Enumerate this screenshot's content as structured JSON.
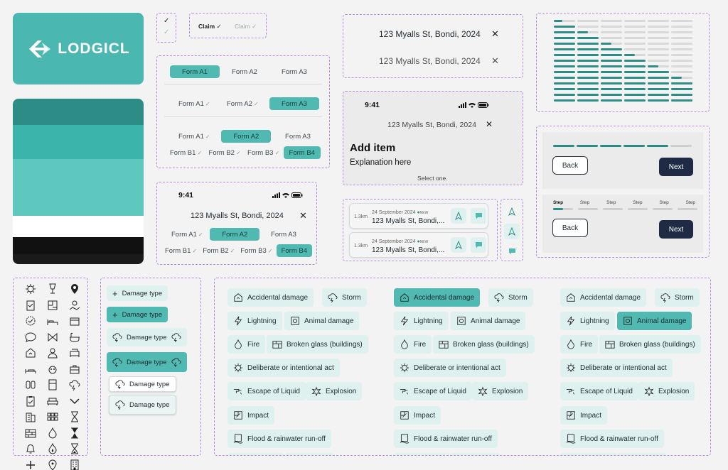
{
  "brand": {
    "name": "LODGICL",
    "color": "#4ab8b0"
  },
  "palette": [
    "#2e8c86",
    "#3bb5ac",
    "#5ec7be",
    "#ffffff",
    "#1a1a1a"
  ],
  "claim": {
    "label_active": "Claim",
    "label_inactive": "Claim"
  },
  "forms": {
    "row1": [
      "Form A1",
      "Form A2",
      "Form A3"
    ],
    "row2": [
      "Form A1",
      "Form A2",
      "Form A3"
    ],
    "row3a": [
      "Form A1",
      "Form A2",
      "Form A3"
    ],
    "row3b": [
      "Form B1",
      "Form B2",
      "Form B3",
      "Form B4"
    ]
  },
  "phone": {
    "time": "9:41",
    "address": "123 Myalls St, Bondi, 2024"
  },
  "addresses": [
    "123 Myalls St, Bondi, 2024",
    "123 Myalls St, Bondi, 2024"
  ],
  "add_item": {
    "time": "9:41",
    "address": "123 Myalls St, Bondi, 2024",
    "title": "Add item",
    "subtitle": "Explanation here",
    "hint": "Select one."
  },
  "list_items": [
    {
      "distance": "1.3km",
      "date": "24 September 2024",
      "badge": "NEW",
      "address": "123 Myalls St, Bondi,..."
    },
    {
      "distance": "1.3km",
      "date": "24 September 2024",
      "badge": "NEW",
      "address": "123 Myalls St, Bondi,..."
    }
  ],
  "nav": {
    "back": "Back",
    "next": "Next",
    "step": "Step",
    "steps": [
      "Step",
      "Step",
      "Step",
      "Step",
      "Step",
      "Step"
    ]
  },
  "damage_type": {
    "label": "Damage type"
  },
  "damage_options": [
    "Accidental damage",
    "Storm",
    "Lightning",
    "Animal damage",
    "Fire",
    "Broken glass (buildings)",
    "Deliberate or intentional act",
    "Escape of Liquid",
    "Explosion",
    "Impact",
    "Flood & rainwater run-off"
  ],
  "accent": "#4fb9b2",
  "dark_button": "#1f2b44"
}
